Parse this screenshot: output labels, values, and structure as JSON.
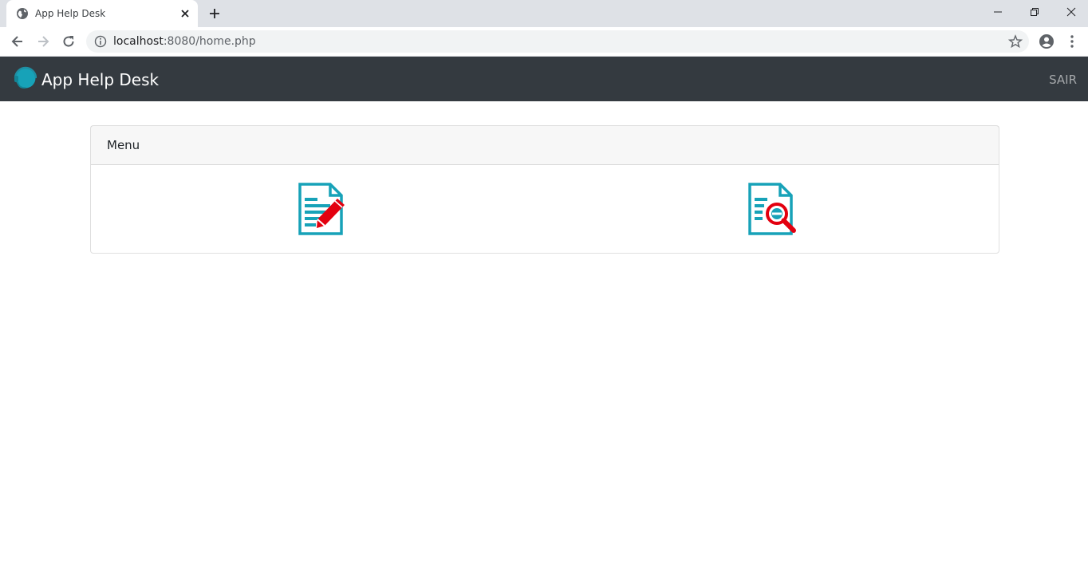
{
  "browser": {
    "tab_title": "App Help Desk",
    "url_host": "localhost",
    "url_path": ":8080/home.php"
  },
  "navbar": {
    "brand": "App Help Desk",
    "logout_label": "SAIR",
    "background": "#343a40"
  },
  "card": {
    "header": "Menu",
    "items": [
      {
        "icon": "document-edit-icon",
        "action": "abrir-chamado"
      },
      {
        "icon": "document-search-icon",
        "action": "consultar-chamado"
      }
    ]
  },
  "colors": {
    "icon_teal": "#17a2b8",
    "icon_red": "#e3000f"
  }
}
